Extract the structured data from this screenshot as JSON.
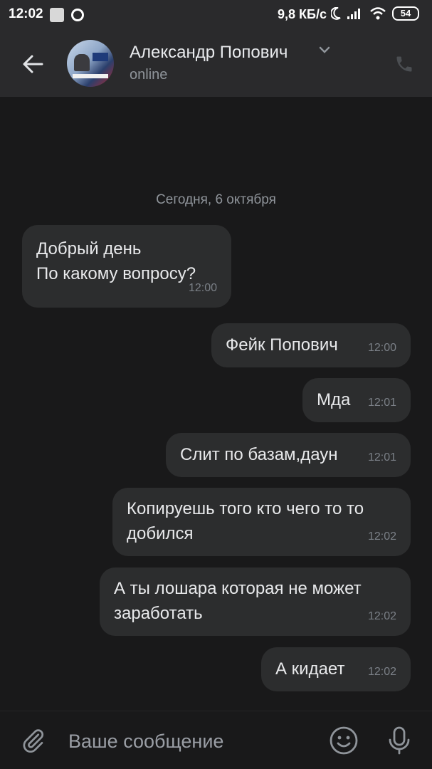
{
  "status_bar": {
    "time": "12:02",
    "network_speed": "9,8 КБ/с",
    "battery": "54"
  },
  "header": {
    "contact_name": "Александр Попович",
    "contact_status": "online"
  },
  "chat": {
    "date_separator": "Сегодня, 6 октября",
    "messages": [
      {
        "text": "Добрый день\nПо какому вопросу?",
        "time": "12:00",
        "direction": "incoming"
      },
      {
        "text": "Фейк Попович",
        "time": "12:00",
        "direction": "outgoing"
      },
      {
        "text": "Мда",
        "time": "12:01",
        "direction": "outgoing"
      },
      {
        "text": "Слит по базам,даун",
        "time": "12:01",
        "direction": "outgoing"
      },
      {
        "text": "Копируешь того кто чего то то\nдобился",
        "time": "12:02",
        "direction": "outgoing"
      },
      {
        "text": "А ты лошара которая не может\nзаработать",
        "time": "12:02",
        "direction": "outgoing"
      },
      {
        "text": "А кидает",
        "time": "12:02",
        "direction": "outgoing"
      }
    ]
  },
  "composer": {
    "placeholder": "Ваше сообщение"
  },
  "icons": {
    "back": "arrow-left-icon",
    "chevron": "chevron-down-icon",
    "call": "phone-icon",
    "attach": "paperclip-icon",
    "emoji": "smile-icon",
    "mic": "microphone-icon"
  },
  "colors": {
    "background": "#19191a",
    "bar": "#2a2a2c",
    "bubble": "#2c2d2e",
    "muted_text": "#8f949a"
  }
}
